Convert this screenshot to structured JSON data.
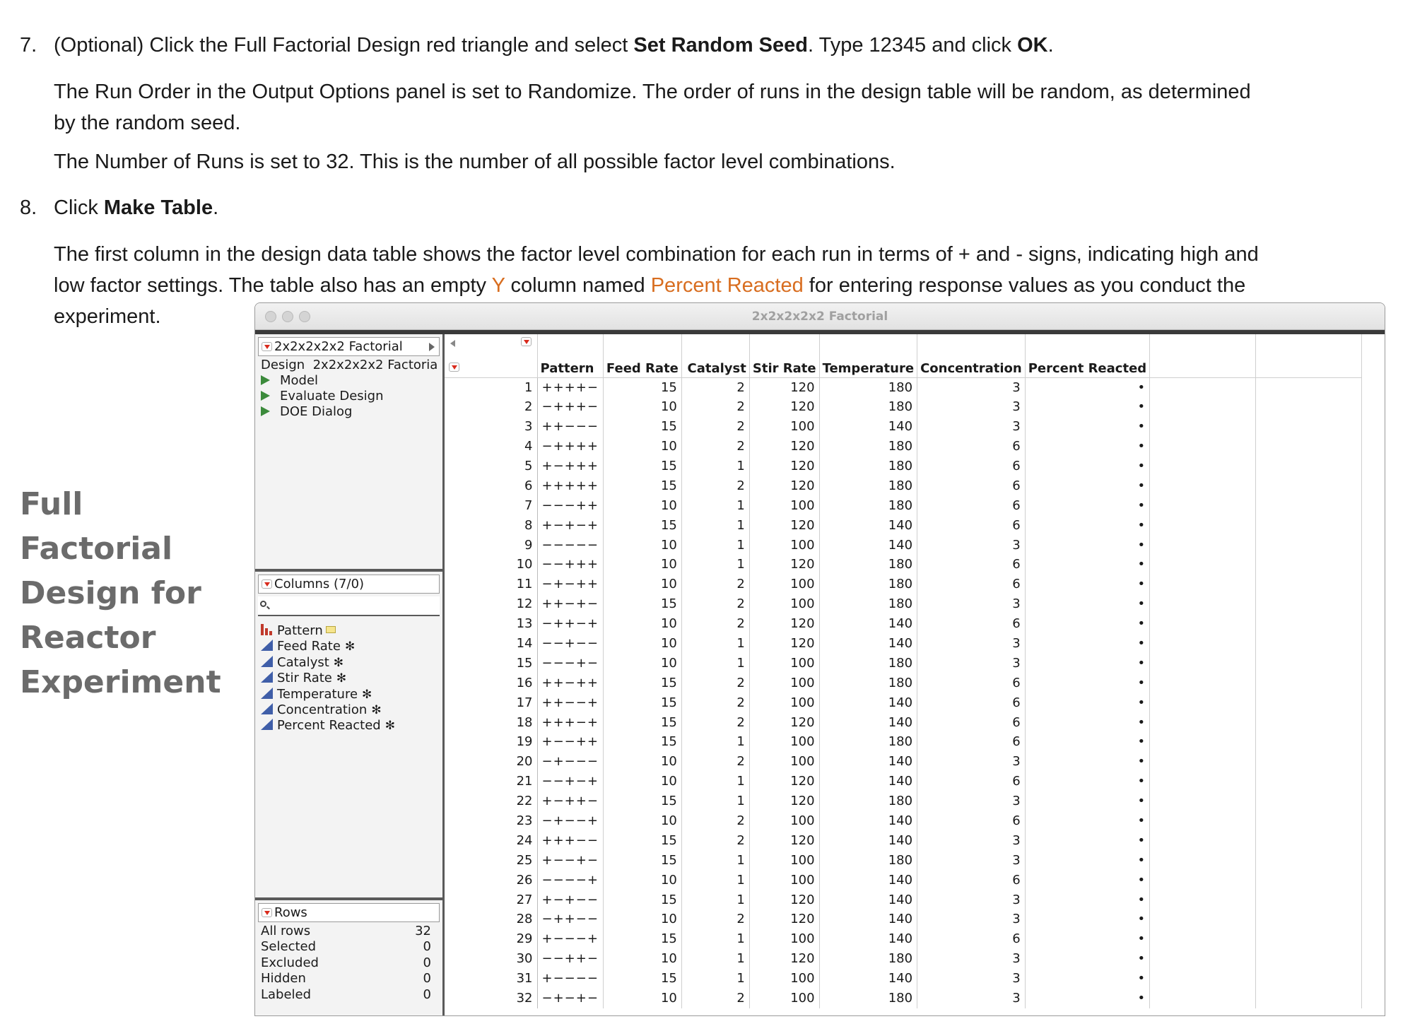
{
  "doc": {
    "step7": {
      "num": "7.",
      "pre": "(Optional) Click the Full Factorial Design red triangle and select ",
      "b1": "Set Random Seed",
      "mid": ". Type 12345 and click ",
      "b2": "OK",
      "end": "."
    },
    "p7a_line1": "The Run Order in the Output Options panel is set to Randomize. The order of runs in the design table will be random, as determined",
    "p7a_line2": "by the random seed.",
    "p7b": "The Number of Runs is set to 32. This is the number of all possible factor level combinations.",
    "step8": {
      "num": "8.",
      "pre": "Click ",
      "b1": "Make Table",
      "end": "."
    },
    "p8_line1": "The first column in the design data table shows the factor level combination for each run in terms of + and - signs, indicating high and",
    "p8_line2_pre": "low factor settings. The table also has an empty ",
    "p8_line2_y": "Y",
    "p8_line2_mid": " column named ",
    "p8_line2_name": "Percent Reacted",
    "p8_line2_end": " for entering response values as you conduct the",
    "p8_line3": "experiment."
  },
  "side_title": [
    "Full Factorial",
    "Design for",
    "Reactor",
    "Experiment"
  ],
  "window": {
    "title": "2x2x2x2x2 Factorial",
    "table_panel": {
      "header": "2x2x2x2x2 Factorial",
      "design_label": "Design",
      "design_value": "2x2x2x2x2 Factoria",
      "scripts": [
        "Model",
        "Evaluate Design",
        "DOE Dialog"
      ]
    },
    "columns_panel": {
      "header": "Columns (7/0)",
      "items": [
        {
          "name": "Pattern",
          "type": "nominal",
          "icon": "bar-chart-icon"
        },
        {
          "name": "Feed Rate",
          "type": "continuous",
          "icon": "continuous-icon"
        },
        {
          "name": "Catalyst",
          "type": "continuous",
          "icon": "continuous-icon"
        },
        {
          "name": "Stir Rate",
          "type": "continuous",
          "icon": "continuous-icon"
        },
        {
          "name": "Temperature",
          "type": "continuous",
          "icon": "continuous-icon"
        },
        {
          "name": "Concentration",
          "type": "continuous",
          "icon": "continuous-icon"
        },
        {
          "name": "Percent Reacted",
          "type": "continuous",
          "icon": "continuous-icon"
        }
      ],
      "star": "✻"
    },
    "rows_panel": {
      "header": "Rows",
      "stats": [
        {
          "label": "All rows",
          "value": "32"
        },
        {
          "label": "Selected",
          "value": "0"
        },
        {
          "label": "Excluded",
          "value": "0"
        },
        {
          "label": "Hidden",
          "value": "0"
        },
        {
          "label": "Labeled",
          "value": "0"
        }
      ]
    },
    "table": {
      "headers": [
        "Pattern",
        "Feed Rate",
        "Catalyst",
        "Stir Rate",
        "Temperature",
        "Concentration",
        "Percent Reacted"
      ],
      "missing": "•",
      "rows": [
        [
          "1",
          "++++−",
          "15",
          "2",
          "120",
          "180",
          "3"
        ],
        [
          "2",
          "−+++−",
          "10",
          "2",
          "120",
          "180",
          "3"
        ],
        [
          "3",
          "++−−−",
          "15",
          "2",
          "100",
          "140",
          "3"
        ],
        [
          "4",
          "−++++",
          "10",
          "2",
          "120",
          "180",
          "6"
        ],
        [
          "5",
          "+−+++",
          "15",
          "1",
          "120",
          "180",
          "6"
        ],
        [
          "6",
          "+++++",
          "15",
          "2",
          "120",
          "180",
          "6"
        ],
        [
          "7",
          "−−−++",
          "10",
          "1",
          "100",
          "180",
          "6"
        ],
        [
          "8",
          "+−+−+",
          "15",
          "1",
          "120",
          "140",
          "6"
        ],
        [
          "9",
          "−−−−−",
          "10",
          "1",
          "100",
          "140",
          "3"
        ],
        [
          "10",
          "−−+++",
          "10",
          "1",
          "120",
          "180",
          "6"
        ],
        [
          "11",
          "−+−++",
          "10",
          "2",
          "100",
          "180",
          "6"
        ],
        [
          "12",
          "++−+−",
          "15",
          "2",
          "100",
          "180",
          "3"
        ],
        [
          "13",
          "−++−+",
          "10",
          "2",
          "120",
          "140",
          "6"
        ],
        [
          "14",
          "−−+−−",
          "10",
          "1",
          "120",
          "140",
          "3"
        ],
        [
          "15",
          "−−−+−",
          "10",
          "1",
          "100",
          "180",
          "3"
        ],
        [
          "16",
          "++−++",
          "15",
          "2",
          "100",
          "180",
          "6"
        ],
        [
          "17",
          "++−−+",
          "15",
          "2",
          "100",
          "140",
          "6"
        ],
        [
          "18",
          "+++−+",
          "15",
          "2",
          "120",
          "140",
          "6"
        ],
        [
          "19",
          "+−−++",
          "15",
          "1",
          "100",
          "180",
          "6"
        ],
        [
          "20",
          "−+−−−",
          "10",
          "2",
          "100",
          "140",
          "3"
        ],
        [
          "21",
          "−−+−+",
          "10",
          "1",
          "120",
          "140",
          "6"
        ],
        [
          "22",
          "+−++−",
          "15",
          "1",
          "120",
          "180",
          "3"
        ],
        [
          "23",
          "−+−−+",
          "10",
          "2",
          "100",
          "140",
          "6"
        ],
        [
          "24",
          "+++−−",
          "15",
          "2",
          "120",
          "140",
          "3"
        ],
        [
          "25",
          "+−−+−",
          "15",
          "1",
          "100",
          "180",
          "3"
        ],
        [
          "26",
          "−−−−+",
          "10",
          "1",
          "100",
          "140",
          "6"
        ],
        [
          "27",
          "+−+−−",
          "15",
          "1",
          "120",
          "140",
          "3"
        ],
        [
          "28",
          "−++−−",
          "10",
          "2",
          "120",
          "140",
          "3"
        ],
        [
          "29",
          "+−−−+",
          "15",
          "1",
          "100",
          "140",
          "6"
        ],
        [
          "30",
          "−−++−",
          "10",
          "1",
          "120",
          "180",
          "3"
        ],
        [
          "31",
          "+−−−−",
          "15",
          "1",
          "100",
          "140",
          "3"
        ],
        [
          "32",
          "−+−+−",
          "10",
          "2",
          "100",
          "180",
          "3"
        ]
      ]
    }
  },
  "colors": {
    "accent_orange": "#d86d1f",
    "side_title_gray": "#6b6b6b",
    "red_triangle": "#d92a1c",
    "script_green": "#3b8a3b",
    "continuous_blue": "#3f5ea8"
  }
}
